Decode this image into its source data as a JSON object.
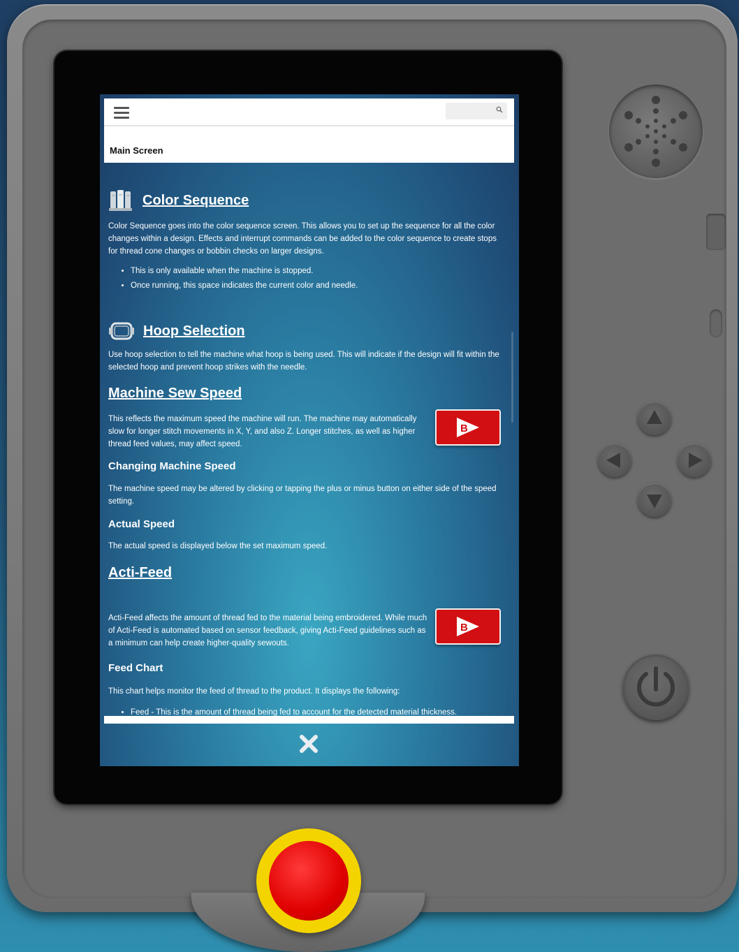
{
  "header": {
    "page_title": "Main Screen",
    "search_placeholder": ""
  },
  "sections": {
    "color_sequence": {
      "title": "Color Sequence",
      "body": "Color Sequence goes into the color sequence screen. This allows you to set up the sequence for all the color changes within a design. Effects and interrupt commands can be added to the color sequence to create stops for thread cone changes or bobbin checks on larger designs.",
      "bullets": [
        "This is only available when the machine is stopped.",
        "Once running, this space indicates the current color and needle."
      ]
    },
    "hoop_selection": {
      "title": "Hoop Selection",
      "body": "Use hoop selection to tell the machine what hoop is being used. This will indicate if the design will fit within the selected hoop and prevent hoop strikes with the needle."
    },
    "machine_sew_speed": {
      "title": "Machine Sew Speed",
      "body": "This reflects the maximum speed the machine will run. The machine may automatically slow for longer stitch movements in X, Y, and also Z. Longer stitches, as well as higher thread feed values, may affect speed.",
      "sub1_title": "Changing Machine Speed",
      "sub1_body": "The machine speed may be altered by clicking or tapping the plus or minus button on either side of the speed setting.",
      "sub2_title": "Actual Speed",
      "sub2_body": "The actual speed is displayed below the set maximum speed."
    },
    "acti_feed": {
      "title": "Acti-Feed",
      "body": "Acti-Feed affects the amount of thread fed to the material being embroidered. While much of Acti-Feed is automated based on sensor feedback, giving Acti-Feed guidelines such as a minimum can help create higher-quality sewouts.",
      "sub1_title": "Feed Chart",
      "sub1_body": "This chart helps monitor the feed of thread to the product. It displays the following:",
      "bullets": [
        "Feed - This is the amount of thread being fed to account for the detected material thickness."
      ]
    }
  },
  "video_button": {
    "label": "B"
  },
  "colors": {
    "accent_red": "#d20f12",
    "estop_yellow": "#f3d400",
    "estop_red": "#e00000",
    "device_gray": "#7a7a7a"
  },
  "icons": [
    "menu-icon",
    "search-icon",
    "spools-icon",
    "hoop-icon",
    "video-play-icon",
    "close-icon",
    "power-icon"
  ]
}
